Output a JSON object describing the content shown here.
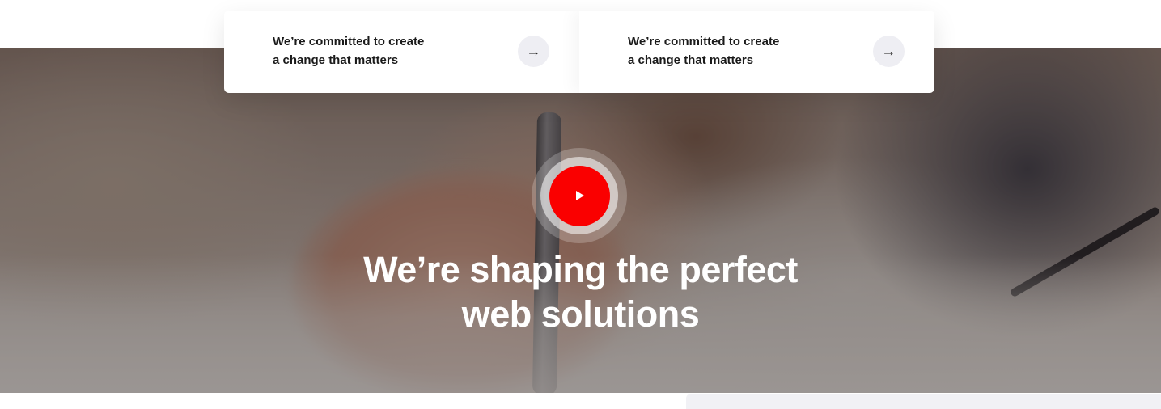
{
  "cards": [
    {
      "line1": "We’re committed to create",
      "line2": "a change that matters",
      "arrow": "→"
    },
    {
      "line1": "We’re committed to create",
      "line2": "a change that matters",
      "arrow": "→"
    }
  ],
  "hero": {
    "headline_line1": "We’re shaping the perfect",
    "headline_line2": "web solutions"
  },
  "colors": {
    "play_button": "#fa0000",
    "arrow_button_bg": "#eeeef3",
    "card_text": "#1a1a1a"
  },
  "icons": {
    "arrow": "arrow-right-icon",
    "play": "play-icon"
  }
}
